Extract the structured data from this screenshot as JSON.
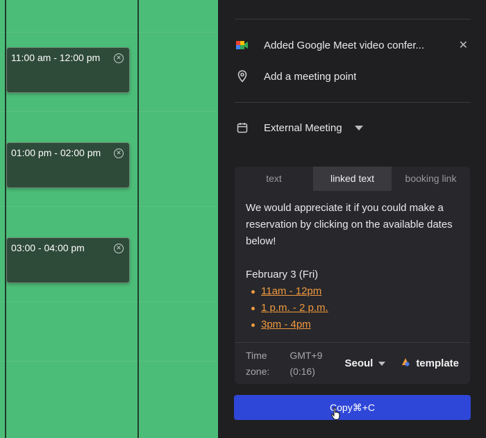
{
  "calendar": {
    "slots": [
      {
        "time": "11:00 am - 12:00 pm"
      },
      {
        "time": "01:00 pm - 02:00 pm"
      },
      {
        "time": "03:00 - 04:00 pm"
      }
    ],
    "slot_close_icon": "close-circle-icon",
    "background_color": "#4cbd78"
  },
  "panel": {
    "conference": {
      "icon": "google-meet-icon",
      "label": "Added Google Meet video confer...",
      "remove_icon": "close-icon"
    },
    "location": {
      "icon": "map-pin-icon",
      "label": "Add a meeting point"
    },
    "meeting_type": {
      "icon": "calendar-icon",
      "label": "External Meeting"
    },
    "tabs": [
      {
        "label": "text",
        "active": false
      },
      {
        "label": "linked text",
        "active": true
      },
      {
        "label": "booking link",
        "active": false
      }
    ],
    "message": "We would appreciate it if you could make a reservation by clicking on the available dates below!",
    "date_heading": "February 3 (Fri)",
    "links": [
      "11am - 12pm",
      "1 p.m. - 2 p.m.",
      "3pm - 4pm"
    ],
    "timezone": {
      "label": "Time zone:",
      "offset": "GMT+9 (0:16)",
      "city": "Seoul",
      "template_label": "template"
    },
    "copy_button": "Copy⌘+C"
  },
  "colors": {
    "accent": "#2f47d8",
    "link": "#f29a3f",
    "panel_bg": "#1f1f22"
  }
}
